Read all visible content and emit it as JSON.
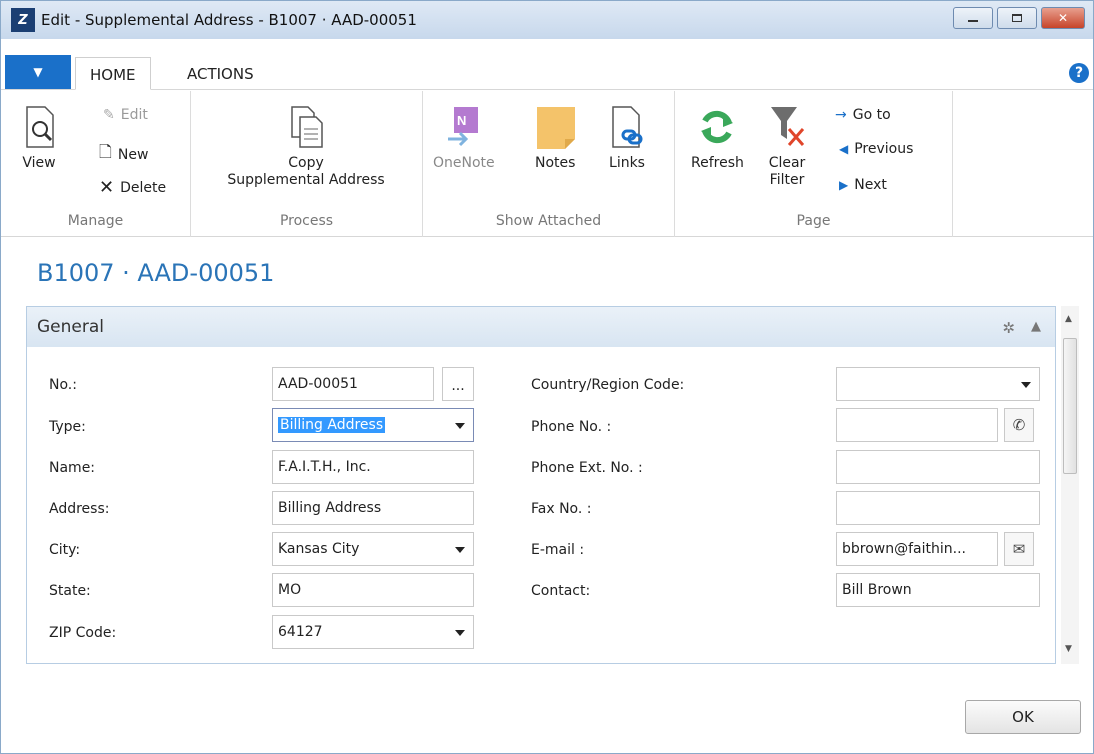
{
  "window": {
    "title": "Edit - Supplemental Address - B1007 · AAD-00051",
    "logo_text": "Z"
  },
  "tabs": {
    "home": "HOME",
    "actions": "ACTIONS",
    "help": "?"
  },
  "ribbon": {
    "manage": {
      "label": "Manage",
      "view": "View",
      "edit": "Edit",
      "new": "New",
      "delete": "Delete"
    },
    "process": {
      "label": "Process",
      "copy_line1": "Copy",
      "copy_line2": "Supplemental Address"
    },
    "show_attached": {
      "label": "Show Attached",
      "onenote": "OneNote",
      "notes": "Notes",
      "links": "Links"
    },
    "page": {
      "label": "Page",
      "refresh": "Refresh",
      "clear_line1": "Clear",
      "clear_line2": "Filter",
      "go_to": "Go to",
      "previous": "Previous",
      "next": "Next"
    }
  },
  "page": {
    "title": "B1007 · AAD-00051"
  },
  "general": {
    "header": "General",
    "left_fields": [
      {
        "label": "No.:",
        "value": "AAD-00051"
      },
      {
        "label": "Type:",
        "value": "Billing Address"
      },
      {
        "label": "Name:",
        "value": "F.A.I.T.H., Inc."
      },
      {
        "label": "Address:",
        "value": "Billing Address"
      },
      {
        "label": "City:",
        "value": "Kansas City"
      },
      {
        "label": "State:",
        "value": "MO"
      },
      {
        "label": "ZIP Code:",
        "value": "64127"
      }
    ],
    "right_fields": [
      {
        "label": "Country/Region Code:",
        "value": ""
      },
      {
        "label": "Phone No. :",
        "value": ""
      },
      {
        "label": "Phone Ext. No. :",
        "value": ""
      },
      {
        "label": "Fax No. :",
        "value": ""
      },
      {
        "label": "E-mail :",
        "value": "bbrown@faithin..."
      },
      {
        "label": "Contact:",
        "value": "Bill Brown"
      }
    ],
    "assist_label": "..."
  },
  "buttons": {
    "ok": "OK"
  },
  "colors": {
    "accent": "#1a70c9",
    "title_blue": "#2a74b7",
    "selection": "#3399ff"
  }
}
